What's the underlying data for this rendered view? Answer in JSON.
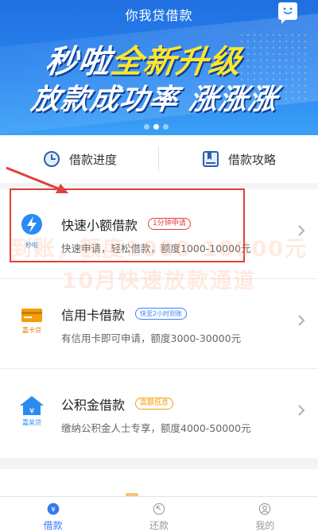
{
  "header": {
    "title": "你我贷借款",
    "promo_line1_white": "秒啦",
    "promo_line1_yellow": "全新升级",
    "promo_line2": "放款成功率 涨涨涨"
  },
  "quick_links": [
    {
      "label": "借款进度",
      "icon": "clock-icon"
    },
    {
      "label": "借款攻略",
      "icon": "book-icon"
    }
  ],
  "products": [
    {
      "name": "快速小额借款",
      "tag": "1分钟申请",
      "tag_color": "#e0403c",
      "desc": "快速申请，轻松借款，额度1000-10000元",
      "logo_caption": "秒啦",
      "logo_color": "#2a8cf0"
    },
    {
      "name": "信用卡借款",
      "tag": "快至2小时到账",
      "tag_color": "#3b82f6",
      "desc": "有信用卡即可申请，额度3000-30000元",
      "logo_caption": "嘉卡贷",
      "logo_color": "#f59e0b"
    },
    {
      "name": "公积金借款",
      "tag": "高额低息",
      "tag_color": "#f59e0b",
      "desc": "缴纳公积金人士专享，额度4000-50000元",
      "logo_caption": "嘉英贷",
      "logo_color": "#2a8cf0"
    }
  ],
  "watermark": {
    "line1": "到账，额度1000-10000元",
    "line2": "10月快速放款通道"
  },
  "bottom_nav": [
    {
      "label": "借款",
      "active": true
    },
    {
      "label": "还款",
      "active": false
    },
    {
      "label": "我的",
      "active": false
    }
  ],
  "colors": {
    "brand_blue": "#2a86f0",
    "promo_yellow": "#ffe62e",
    "highlight_red": "#e0403c"
  }
}
